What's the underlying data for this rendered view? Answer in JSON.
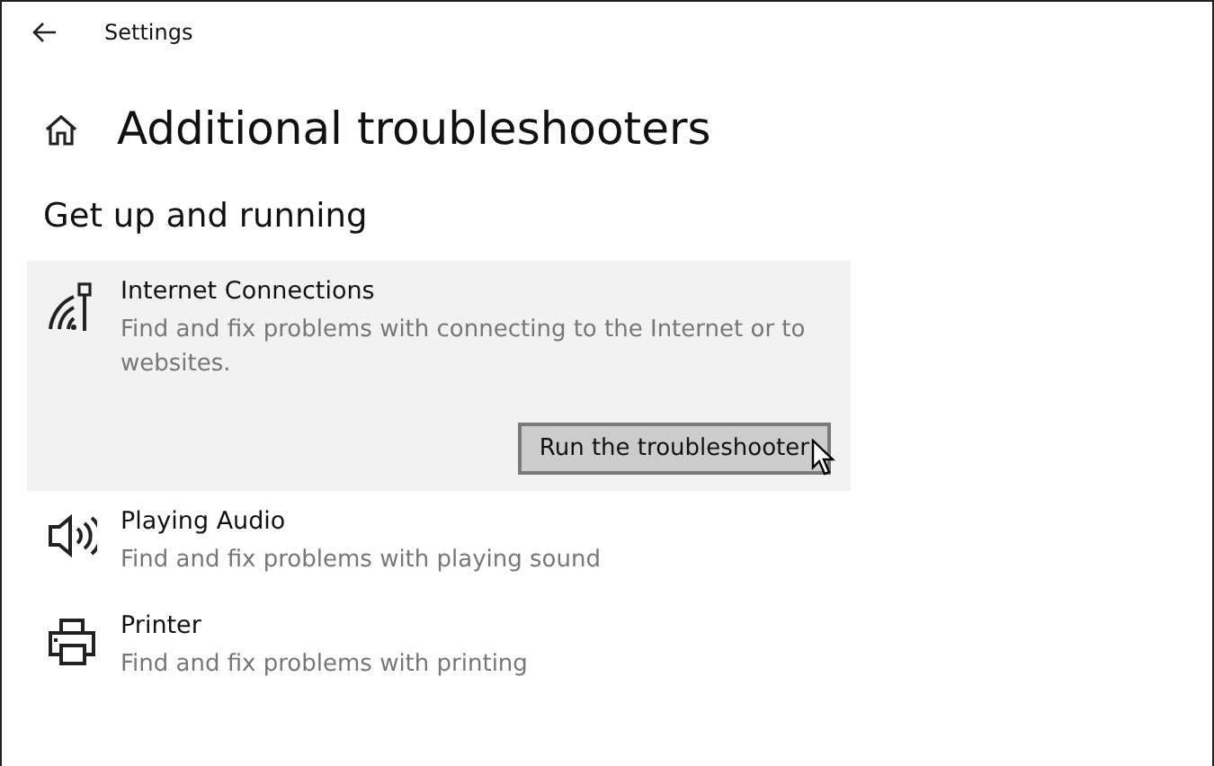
{
  "window": {
    "title": "Settings"
  },
  "page": {
    "title": "Additional troubleshooters"
  },
  "section": {
    "title": "Get up and running"
  },
  "troubleshooters": [
    {
      "title": "Internet Connections",
      "description": "Find and fix problems with connecting to the Internet or to websites.",
      "selected": true,
      "button": "Run the troubleshooter"
    },
    {
      "title": "Playing Audio",
      "description": "Find and fix problems with playing sound",
      "selected": false
    },
    {
      "title": "Printer",
      "description": "Find and fix problems with printing",
      "selected": false
    }
  ]
}
